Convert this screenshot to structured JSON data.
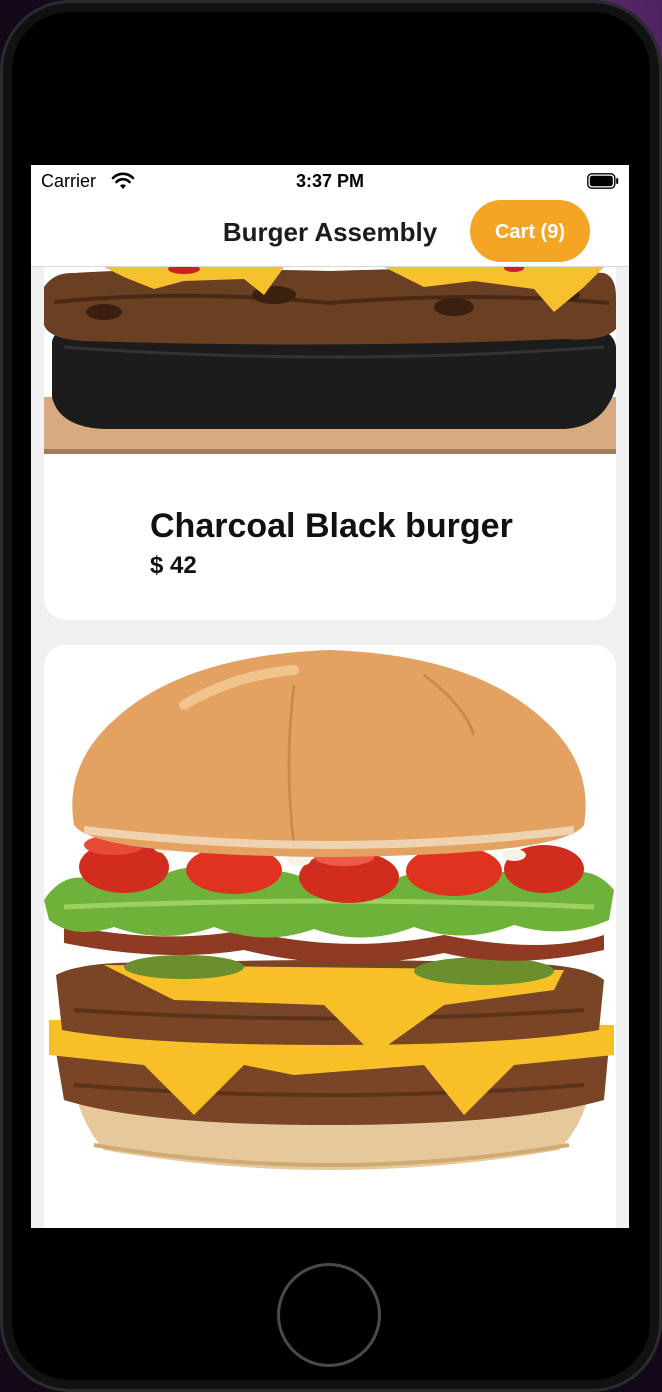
{
  "status": {
    "carrier": "Carrier",
    "time": "3:37 PM"
  },
  "nav": {
    "title": "Burger Assembly",
    "cart_label": "Cart (9)"
  },
  "products": [
    {
      "name": "Charcoal Black burger",
      "price": "$ 42",
      "image": "charcoal-burger-photo"
    },
    {
      "name": "",
      "price": "",
      "image": "double-cheeseburger-photo"
    }
  ],
  "colors": {
    "accent": "#f5a524",
    "screen_bg": "#f0f0f0"
  }
}
